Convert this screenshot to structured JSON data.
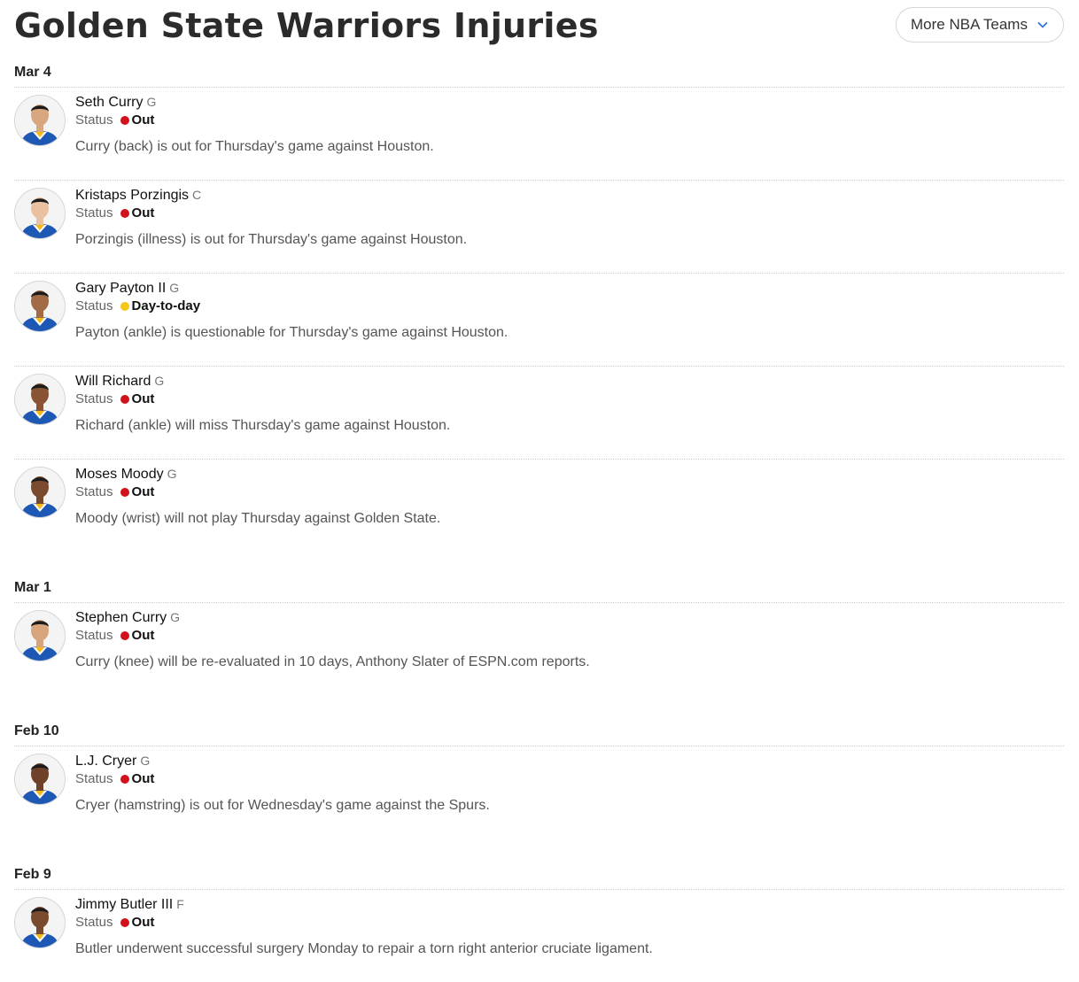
{
  "header": {
    "title": "Golden State Warriors Injuries",
    "teams_button": "More NBA Teams"
  },
  "status_label": "Status",
  "colors": {
    "out": "#d1121b",
    "day_to_day": "#f5c518",
    "jersey": "#1d58b4",
    "skin_light": "#e8b898",
    "skin_mid": "#b77b54",
    "skin_dark": "#6b4027"
  },
  "groups": [
    {
      "date": "Mar 4",
      "entries": [
        {
          "name": "Seth Curry",
          "position": "G",
          "status": "Out",
          "status_type": "out",
          "skin": "#d9a77f",
          "note": "Curry (back) is out for Thursday's game against Houston."
        },
        {
          "name": "Kristaps Porzingis",
          "position": "C",
          "status": "Out",
          "status_type": "out",
          "skin": "#e9c0a0",
          "note": "Porzingis (illness) is out for Thursday's game against Houston."
        },
        {
          "name": "Gary Payton II",
          "position": "G",
          "status": "Day-to-day",
          "status_type": "day",
          "skin": "#a26a45",
          "note": "Payton (ankle) is questionable for Thursday's game against Houston."
        },
        {
          "name": "Will Richard",
          "position": "G",
          "status": "Out",
          "status_type": "out",
          "skin": "#8a5434",
          "note": "Richard (ankle) will miss Thursday's game against Houston."
        },
        {
          "name": "Moses Moody",
          "position": "G",
          "status": "Out",
          "status_type": "out",
          "skin": "#7a4a2e",
          "note": "Moody (wrist) will not play Thursday against Golden State."
        }
      ]
    },
    {
      "date": "Mar 1",
      "entries": [
        {
          "name": "Stephen Curry",
          "position": "G",
          "status": "Out",
          "status_type": "out",
          "skin": "#d8a47c",
          "note": "Curry (knee) will be re-evaluated in 10 days, Anthony Slater of ESPN.com reports."
        }
      ]
    },
    {
      "date": "Feb 10",
      "entries": [
        {
          "name": "L.J. Cryer",
          "position": "G",
          "status": "Out",
          "status_type": "out",
          "skin": "#6e4128",
          "note": "Cryer (hamstring) is out for Wednesday's game against the Spurs."
        }
      ]
    },
    {
      "date": "Feb 9",
      "entries": [
        {
          "name": "Jimmy Butler III",
          "position": "F",
          "status": "Out",
          "status_type": "out",
          "skin": "#7a4a2e",
          "note": "Butler underwent successful surgery Monday to repair a torn right anterior cruciate ligament."
        }
      ]
    }
  ]
}
